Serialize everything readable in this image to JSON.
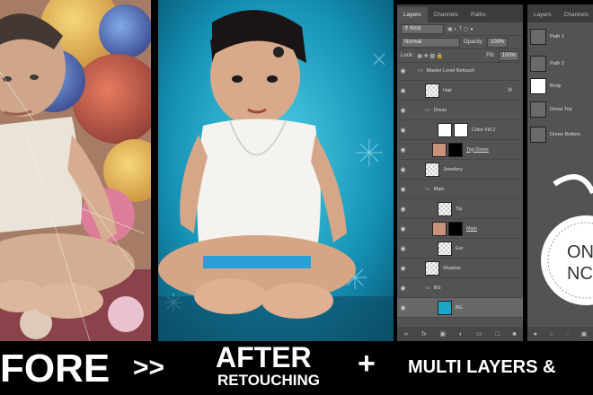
{
  "banner": {
    "before": "FORE",
    "arrows": ">>",
    "after_line1": "AFTER",
    "after_line2": "RETOUCHING",
    "plus": "+",
    "multi": "MULTI LAYERS &"
  },
  "layers_panel": {
    "tabs": [
      "Layers",
      "Channels",
      "Paths"
    ],
    "kind_label": "Kind",
    "blend_mode": "Normal",
    "opacity_label": "Opacity:",
    "opacity_value": "100%",
    "lock_label": "Lock:",
    "fill_label": "Fill:",
    "fill_value": "100%",
    "layers": [
      {
        "name": "Master Level Retouch",
        "type": "group",
        "indent": 0
      },
      {
        "name": "Hair",
        "type": "layer",
        "indent": 1
      },
      {
        "name": "Dress",
        "type": "group",
        "indent": 1
      },
      {
        "name": "Color Fill 2",
        "type": "fill",
        "indent": 2
      },
      {
        "name": "Top Dress",
        "type": "masked",
        "indent": 2
      },
      {
        "name": "Jewelery",
        "type": "layer",
        "indent": 1
      },
      {
        "name": "Main",
        "type": "group",
        "indent": 1
      },
      {
        "name": "Tip",
        "type": "layer",
        "indent": 2
      },
      {
        "name": "Main",
        "type": "masked",
        "indent": 2
      },
      {
        "name": "Ear",
        "type": "layer",
        "indent": 2
      },
      {
        "name": "Shadow",
        "type": "layer",
        "indent": 1
      },
      {
        "name": "BG",
        "type": "group",
        "indent": 1
      },
      {
        "name": "BG",
        "type": "bg",
        "indent": 2
      }
    ]
  },
  "paths_panel": {
    "tabs": [
      "Layers",
      "Channels"
    ],
    "paths": [
      "Path 1",
      "Path 2",
      "Body",
      "Dress Top",
      "Dreee Bottom"
    ],
    "badge_text_1": "ON",
    "badge_text_2": "NC"
  },
  "colors": {
    "ps_bg": "#535353",
    "accent_blue": "#1ba7c9"
  }
}
